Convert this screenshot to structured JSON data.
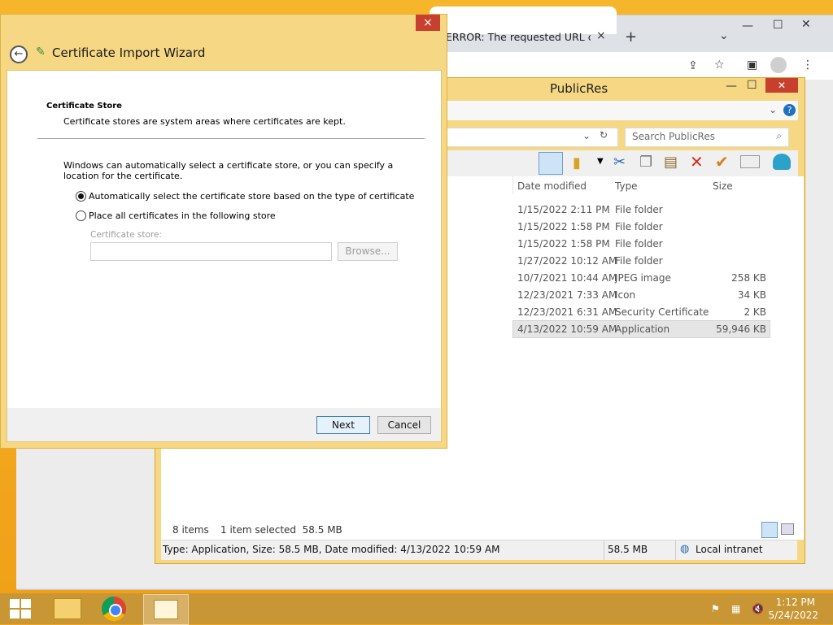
{
  "chrome": {
    "tab_title": "ERROR: The requested URL could",
    "new_tab_icon": "plus-icon",
    "tab_close": "×"
  },
  "explorer": {
    "title": "PublicRes",
    "search_placeholder": "Search PublicRes",
    "columns": [
      "Date modified",
      "Type",
      "Size"
    ],
    "rows": [
      {
        "date": "1/15/2022 2:11 PM",
        "type": "File folder",
        "size": ""
      },
      {
        "date": "1/15/2022 1:58 PM",
        "type": "File folder",
        "size": ""
      },
      {
        "date": "1/15/2022 1:58 PM",
        "type": "File folder",
        "size": ""
      },
      {
        "date": "1/27/2022 10:12 AM",
        "type": "File folder",
        "size": ""
      },
      {
        "date": "10/7/2021 10:44 AM",
        "type": "JPEG image",
        "size": "258 KB"
      },
      {
        "date": "12/23/2021 7:33 AM",
        "type": "Icon",
        "size": "34 KB"
      },
      {
        "date": "12/23/2021 6:31 AM",
        "type": "Security Certificate",
        "size": "2 KB"
      },
      {
        "date": "4/13/2022 10:59 AM",
        "type": "Application",
        "size": "59,946 KB"
      }
    ],
    "status_items": "8 items",
    "status_selected": "1 item selected  58.5 MB",
    "info_text": "Type: Application, Size: 58.5 MB, Date modified: 4/13/2022 10:59 AM",
    "info_size": "58.5 MB",
    "info_zone": "Local intranet"
  },
  "dialog": {
    "title": "Certificate Import Wizard",
    "heading": "Certificate Store",
    "subheading": "Certificate stores are system areas where certificates are kept.",
    "description": "Windows can automatically select a certificate store, or you can specify a location for the certificate.",
    "option_auto": "Automatically select the certificate store based on the type of certificate",
    "option_manual": "Place all certificates in the following store",
    "store_label": "Certificate store:",
    "store_value": "",
    "browse_label": "Browse...",
    "next_label": "Next",
    "cancel_label": "Cancel",
    "close_label": "×"
  },
  "taskbar": {
    "time": "1:12 PM",
    "date": "5/24/2022"
  }
}
